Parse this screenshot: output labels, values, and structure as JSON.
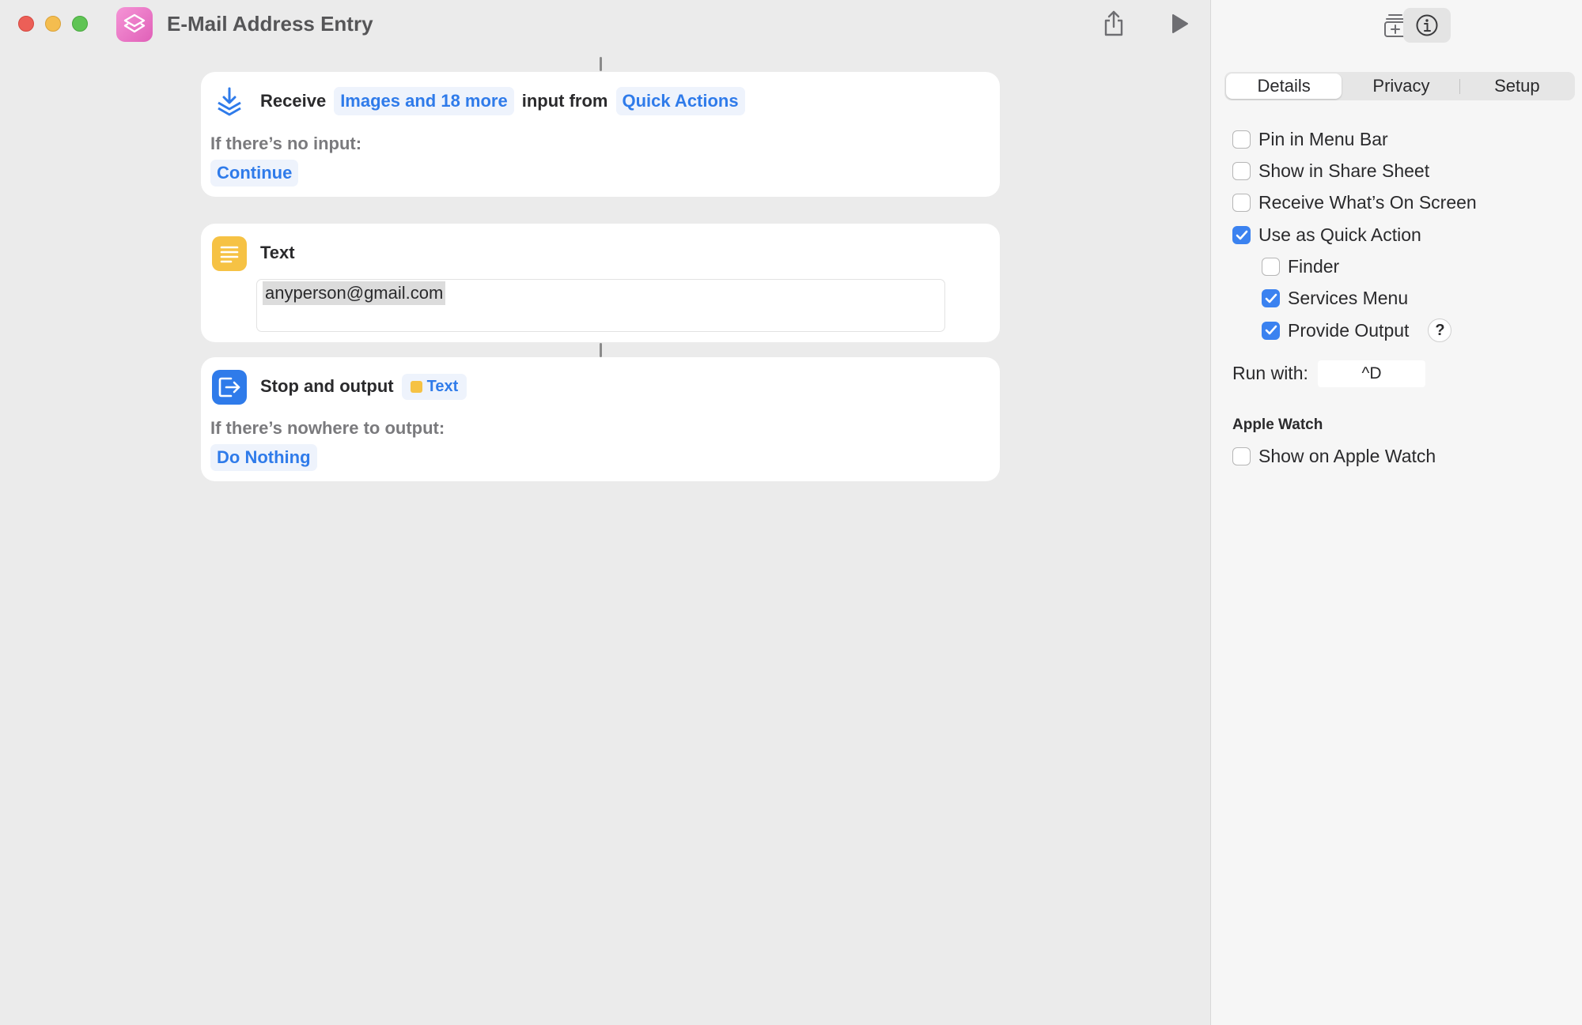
{
  "window": {
    "title": "E-Mail Address Entry"
  },
  "toolbar": {
    "share_icon": "share-icon",
    "run_icon": "play-icon"
  },
  "actions": {
    "receive": {
      "label": "Receive",
      "input_types": "Images and 18 more",
      "connector": "input from",
      "source": "Quick Actions",
      "no_input_label": "If there’s no input:",
      "no_input_value": "Continue"
    },
    "text": {
      "label": "Text",
      "value": "anyperson@gmail.com"
    },
    "stop": {
      "label": "Stop and output",
      "output_token": "Text",
      "nowhere_label": "If there’s nowhere to output:",
      "nowhere_value": "Do Nothing"
    }
  },
  "sidebar": {
    "tabs": [
      {
        "label": "Details",
        "active": true
      },
      {
        "label": "Privacy",
        "active": false
      },
      {
        "label": "Setup",
        "active": false
      }
    ],
    "options": [
      {
        "label": "Pin in Menu Bar",
        "checked": false
      },
      {
        "label": "Show in Share Sheet",
        "checked": false
      },
      {
        "label": "Receive What’s On Screen",
        "checked": false
      },
      {
        "label": "Use as Quick Action",
        "checked": true
      },
      {
        "label": "Finder",
        "checked": false
      },
      {
        "label": "Services Menu",
        "checked": true
      },
      {
        "label": "Provide Output",
        "checked": true
      }
    ],
    "help_label": "?",
    "run_with_label": "Run with:",
    "shortcut": "^D",
    "apple_watch_header": "Apple Watch",
    "apple_watch_option": {
      "label": "Show on Apple Watch",
      "checked": false
    }
  },
  "colors": {
    "accent": "#3b82f0",
    "token_text": "#2f7bea",
    "token_bg": "#eef3fc",
    "text_action": "#f6c244",
    "stop_action": "#2f7bea"
  }
}
